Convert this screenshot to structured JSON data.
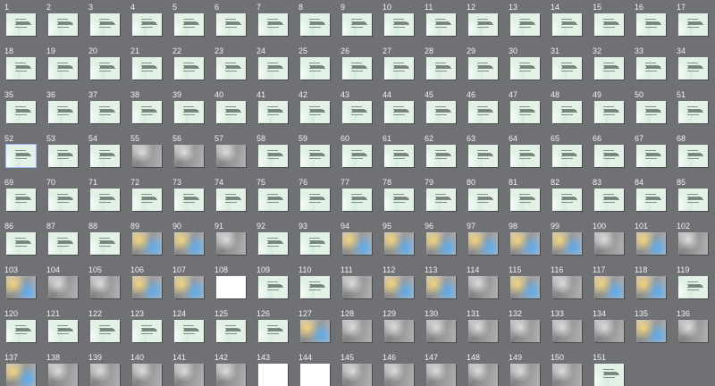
{
  "slides": [
    {
      "n": "1",
      "kind": "text"
    },
    {
      "n": "2",
      "kind": "text"
    },
    {
      "n": "3",
      "kind": "text"
    },
    {
      "n": "4",
      "kind": "text"
    },
    {
      "n": "5",
      "kind": "text"
    },
    {
      "n": "6",
      "kind": "text"
    },
    {
      "n": "7",
      "kind": "text"
    },
    {
      "n": "8",
      "kind": "text"
    },
    {
      "n": "9",
      "kind": "text"
    },
    {
      "n": "10",
      "kind": "text"
    },
    {
      "n": "11",
      "kind": "text"
    },
    {
      "n": "12",
      "kind": "text"
    },
    {
      "n": "13",
      "kind": "text"
    },
    {
      "n": "14",
      "kind": "text"
    },
    {
      "n": "15",
      "kind": "text"
    },
    {
      "n": "16",
      "kind": "text"
    },
    {
      "n": "17",
      "kind": "text"
    },
    {
      "n": "18",
      "kind": "text"
    },
    {
      "n": "19",
      "kind": "text"
    },
    {
      "n": "20",
      "kind": "text"
    },
    {
      "n": "21",
      "kind": "text"
    },
    {
      "n": "22",
      "kind": "text"
    },
    {
      "n": "23",
      "kind": "text"
    },
    {
      "n": "24",
      "kind": "text"
    },
    {
      "n": "25",
      "kind": "text"
    },
    {
      "n": "26",
      "kind": "text"
    },
    {
      "n": "27",
      "kind": "text"
    },
    {
      "n": "28",
      "kind": "text"
    },
    {
      "n": "29",
      "kind": "text"
    },
    {
      "n": "30",
      "kind": "text"
    },
    {
      "n": "31",
      "kind": "text"
    },
    {
      "n": "32",
      "kind": "text"
    },
    {
      "n": "33",
      "kind": "text"
    },
    {
      "n": "34",
      "kind": "text"
    },
    {
      "n": "35",
      "kind": "text"
    },
    {
      "n": "36",
      "kind": "text"
    },
    {
      "n": "37",
      "kind": "text"
    },
    {
      "n": "38",
      "kind": "text"
    },
    {
      "n": "39",
      "kind": "text"
    },
    {
      "n": "40",
      "kind": "text"
    },
    {
      "n": "41",
      "kind": "text"
    },
    {
      "n": "42",
      "kind": "text"
    },
    {
      "n": "43",
      "kind": "text"
    },
    {
      "n": "44",
      "kind": "text"
    },
    {
      "n": "45",
      "kind": "text"
    },
    {
      "n": "46",
      "kind": "text"
    },
    {
      "n": "47",
      "kind": "text"
    },
    {
      "n": "48",
      "kind": "text"
    },
    {
      "n": "49",
      "kind": "text"
    },
    {
      "n": "50",
      "kind": "text"
    },
    {
      "n": "51",
      "kind": "text"
    },
    {
      "n": "52",
      "kind": "text",
      "selected": true
    },
    {
      "n": "53",
      "kind": "text"
    },
    {
      "n": "54",
      "kind": "text"
    },
    {
      "n": "55",
      "kind": "photo"
    },
    {
      "n": "56",
      "kind": "photo"
    },
    {
      "n": "57",
      "kind": "photo"
    },
    {
      "n": "58",
      "kind": "text"
    },
    {
      "n": "59",
      "kind": "text"
    },
    {
      "n": "60",
      "kind": "text"
    },
    {
      "n": "61",
      "kind": "text"
    },
    {
      "n": "62",
      "kind": "text"
    },
    {
      "n": "63",
      "kind": "text"
    },
    {
      "n": "64",
      "kind": "text"
    },
    {
      "n": "65",
      "kind": "text"
    },
    {
      "n": "66",
      "kind": "text"
    },
    {
      "n": "67",
      "kind": "text"
    },
    {
      "n": "68",
      "kind": "text"
    },
    {
      "n": "69",
      "kind": "text"
    },
    {
      "n": "70",
      "kind": "text"
    },
    {
      "n": "71",
      "kind": "text"
    },
    {
      "n": "72",
      "kind": "text"
    },
    {
      "n": "73",
      "kind": "text"
    },
    {
      "n": "74",
      "kind": "text"
    },
    {
      "n": "75",
      "kind": "text"
    },
    {
      "n": "76",
      "kind": "text"
    },
    {
      "n": "77",
      "kind": "text"
    },
    {
      "n": "78",
      "kind": "text"
    },
    {
      "n": "79",
      "kind": "text"
    },
    {
      "n": "80",
      "kind": "text"
    },
    {
      "n": "81",
      "kind": "text"
    },
    {
      "n": "82",
      "kind": "text"
    },
    {
      "n": "83",
      "kind": "text"
    },
    {
      "n": "84",
      "kind": "text"
    },
    {
      "n": "85",
      "kind": "text"
    },
    {
      "n": "86",
      "kind": "text"
    },
    {
      "n": "87",
      "kind": "text"
    },
    {
      "n": "88",
      "kind": "text"
    },
    {
      "n": "89",
      "kind": "photo-color"
    },
    {
      "n": "90",
      "kind": "photo-color"
    },
    {
      "n": "91",
      "kind": "photo"
    },
    {
      "n": "92",
      "kind": "text"
    },
    {
      "n": "93",
      "kind": "text"
    },
    {
      "n": "94",
      "kind": "photo-color"
    },
    {
      "n": "95",
      "kind": "photo-color"
    },
    {
      "n": "96",
      "kind": "photo-color"
    },
    {
      "n": "97",
      "kind": "photo-color"
    },
    {
      "n": "98",
      "kind": "photo-color"
    },
    {
      "n": "99",
      "kind": "photo-color"
    },
    {
      "n": "100",
      "kind": "photo"
    },
    {
      "n": "101",
      "kind": "photo-color"
    },
    {
      "n": "102",
      "kind": "photo"
    },
    {
      "n": "103",
      "kind": "photo-color"
    },
    {
      "n": "104",
      "kind": "photo"
    },
    {
      "n": "105",
      "kind": "photo"
    },
    {
      "n": "106",
      "kind": "photo-color"
    },
    {
      "n": "107",
      "kind": "photo-color"
    },
    {
      "n": "108",
      "kind": "whitebox"
    },
    {
      "n": "109",
      "kind": "text"
    },
    {
      "n": "110",
      "kind": "text"
    },
    {
      "n": "111",
      "kind": "photo"
    },
    {
      "n": "112",
      "kind": "photo-color"
    },
    {
      "n": "113",
      "kind": "photo-color"
    },
    {
      "n": "114",
      "kind": "photo"
    },
    {
      "n": "115",
      "kind": "photo-color"
    },
    {
      "n": "116",
      "kind": "photo"
    },
    {
      "n": "117",
      "kind": "photo-color"
    },
    {
      "n": "118",
      "kind": "photo-color"
    },
    {
      "n": "119",
      "kind": "text"
    },
    {
      "n": "120",
      "kind": "text"
    },
    {
      "n": "121",
      "kind": "text"
    },
    {
      "n": "122",
      "kind": "text"
    },
    {
      "n": "123",
      "kind": "text"
    },
    {
      "n": "124",
      "kind": "text"
    },
    {
      "n": "125",
      "kind": "text"
    },
    {
      "n": "126",
      "kind": "text"
    },
    {
      "n": "127",
      "kind": "photo-color"
    },
    {
      "n": "128",
      "kind": "photo"
    },
    {
      "n": "129",
      "kind": "photo"
    },
    {
      "n": "130",
      "kind": "photo"
    },
    {
      "n": "131",
      "kind": "photo"
    },
    {
      "n": "132",
      "kind": "photo"
    },
    {
      "n": "133",
      "kind": "photo"
    },
    {
      "n": "134",
      "kind": "photo"
    },
    {
      "n": "135",
      "kind": "photo-color"
    },
    {
      "n": "136",
      "kind": "photo"
    },
    {
      "n": "137",
      "kind": "photo-color"
    },
    {
      "n": "138",
      "kind": "photo"
    },
    {
      "n": "139",
      "kind": "photo"
    },
    {
      "n": "140",
      "kind": "photo"
    },
    {
      "n": "141",
      "kind": "photo"
    },
    {
      "n": "142",
      "kind": "photo"
    },
    {
      "n": "143",
      "kind": "whitebox"
    },
    {
      "n": "144",
      "kind": "whitebox"
    },
    {
      "n": "145",
      "kind": "photo"
    },
    {
      "n": "146",
      "kind": "photo"
    },
    {
      "n": "147",
      "kind": "photo"
    },
    {
      "n": "148",
      "kind": "photo"
    },
    {
      "n": "149",
      "kind": "photo"
    },
    {
      "n": "150",
      "kind": "photo"
    },
    {
      "n": "151",
      "kind": "text"
    }
  ]
}
